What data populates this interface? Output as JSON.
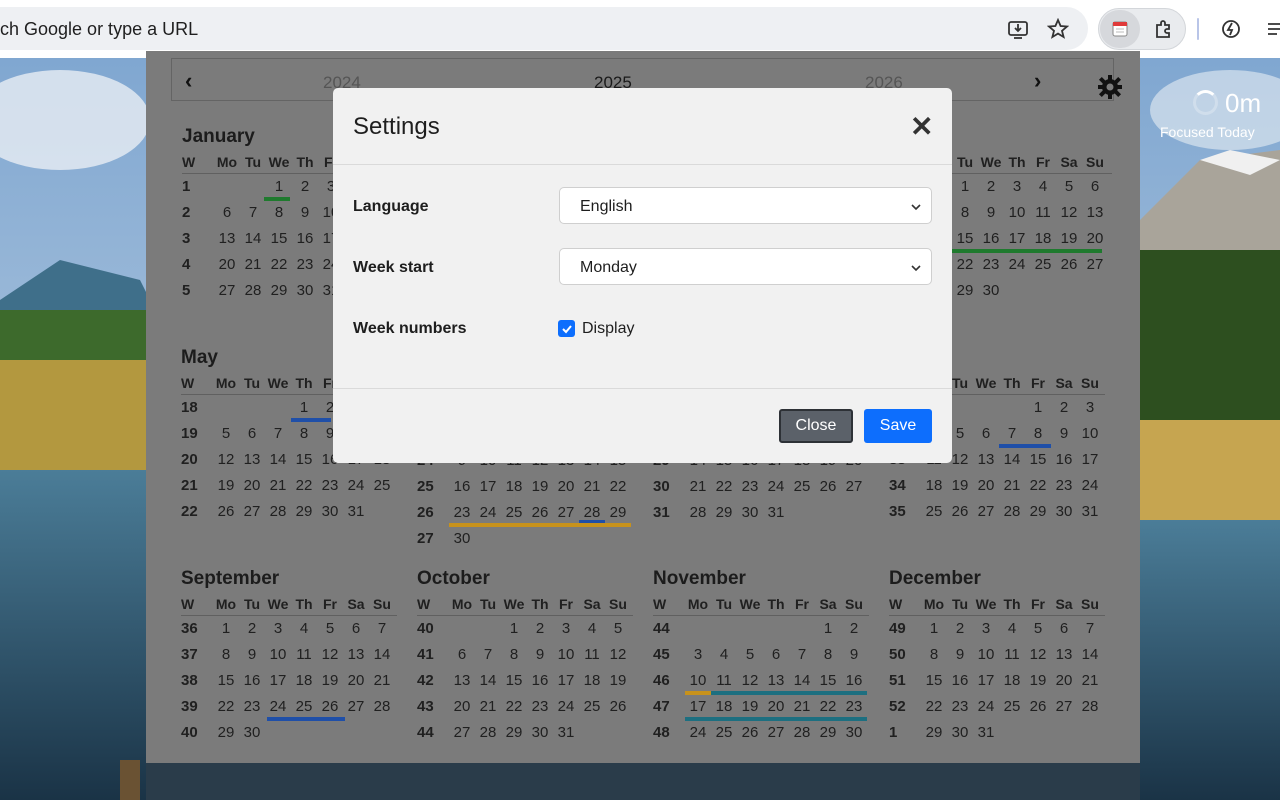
{
  "browser": {
    "omnibox_text": "ch Google or type a URL",
    "icons": [
      "install-app-icon",
      "bookmark-star-icon",
      "calendar-extension-icon",
      "extensions-puzzle-icon",
      "browser-ai-icon",
      "menu-icon"
    ]
  },
  "calendar": {
    "prev_year": "2024",
    "current_year": "2025",
    "next_year": "2026",
    "prev_arrow": "‹",
    "next_arrow": "›",
    "visible_day_headers": [
      "W",
      "Mo",
      "Tu",
      "We",
      "Th",
      "Fr"
    ],
    "full_day_headers": [
      "Tu",
      "We",
      "Th",
      "Fr",
      "Sa",
      "Su"
    ],
    "months": {
      "january": {
        "name": "January",
        "weeks": [
          "1",
          "2",
          "3",
          "4",
          "5"
        ],
        "rows": [
          [
            "",
            "",
            "1",
            "2",
            "3"
          ],
          [
            "6",
            "7",
            "8",
            "9",
            "10"
          ],
          [
            "13",
            "14",
            "15",
            "16",
            "17"
          ],
          [
            "20",
            "21",
            "22",
            "23",
            "24"
          ],
          [
            "27",
            "28",
            "29",
            "30",
            "31"
          ]
        ]
      },
      "april": {
        "rows": [
          [
            "1",
            "2",
            "3",
            "4",
            "5",
            "6"
          ],
          [
            "8",
            "9",
            "10",
            "11",
            "12",
            "13"
          ],
          [
            "15",
            "16",
            "17",
            "18",
            "19",
            "20"
          ],
          [
            "22",
            "23",
            "24",
            "25",
            "26",
            "27"
          ],
          [
            "29",
            "30",
            "",
            "",
            "",
            ""
          ]
        ]
      },
      "may": {
        "name": "May",
        "weeks": [
          "18",
          "19",
          "20",
          "21",
          "22"
        ],
        "rows": [
          [
            "",
            "",
            "",
            "1",
            "2"
          ],
          [
            "5",
            "6",
            "7",
            "8",
            "9"
          ],
          [
            "12",
            "13",
            "14",
            "15",
            "16",
            "17",
            "18"
          ],
          [
            "19",
            "20",
            "21",
            "22",
            "23",
            "24",
            "25"
          ],
          [
            "26",
            "27",
            "28",
            "29",
            "30",
            "31"
          ]
        ]
      },
      "june_partial": {
        "weeks": [
          "24",
          "25",
          "26",
          "27"
        ],
        "rows": [
          [
            "9",
            "10",
            "11",
            "12",
            "13",
            "14",
            "15"
          ],
          [
            "16",
            "17",
            "18",
            "19",
            "20",
            "21",
            "22"
          ],
          [
            "23",
            "24",
            "25",
            "26",
            "27",
            "28",
            "29"
          ],
          [
            "30",
            "",
            "",
            "",
            "",
            "",
            ""
          ]
        ]
      },
      "july_partial": {
        "weeks": [
          "29",
          "30",
          "31"
        ],
        "rows": [
          [
            "14",
            "15",
            "16",
            "17",
            "18",
            "19",
            "20"
          ],
          [
            "21",
            "22",
            "23",
            "24",
            "25",
            "26",
            "27"
          ],
          [
            "28",
            "29",
            "30",
            "31",
            "",
            "",
            ""
          ]
        ]
      },
      "august": {
        "name_fragment": "st",
        "weeks": [
          "33",
          "34",
          "35"
        ],
        "rows": [
          [
            "1",
            "2",
            "3"
          ],
          [
            "5",
            "6",
            "7",
            "8",
            "9",
            "10"
          ],
          [
            "11",
            "12",
            "13",
            "14",
            "15",
            "16",
            "17"
          ],
          [
            "18",
            "19",
            "20",
            "21",
            "22",
            "23",
            "24"
          ],
          [
            "25",
            "26",
            "27",
            "28",
            "29",
            "30",
            "31"
          ]
        ],
        "week_nums_top": [
          "",
          "",
          "33",
          "34",
          "35"
        ]
      },
      "september": {
        "name": "September",
        "weeks": [
          "36",
          "37",
          "38",
          "39",
          "40"
        ],
        "rows": [
          [
            "1",
            "2",
            "3",
            "4",
            "5",
            "6",
            "7"
          ],
          [
            "8",
            "9",
            "10",
            "11",
            "12",
            "13",
            "14"
          ],
          [
            "15",
            "16",
            "17",
            "18",
            "19",
            "20",
            "21"
          ],
          [
            "22",
            "23",
            "24",
            "25",
            "26",
            "27",
            "28"
          ],
          [
            "29",
            "30",
            "",
            "",
            "",
            "",
            ""
          ]
        ]
      },
      "october": {
        "name": "October",
        "weeks": [
          "40",
          "41",
          "42",
          "43",
          "44"
        ],
        "rows": [
          [
            "",
            "",
            "1",
            "2",
            "3",
            "4",
            "5"
          ],
          [
            "6",
            "7",
            "8",
            "9",
            "10",
            "11",
            "12"
          ],
          [
            "13",
            "14",
            "15",
            "16",
            "17",
            "18",
            "19"
          ],
          [
            "20",
            "21",
            "22",
            "23",
            "24",
            "25",
            "26"
          ],
          [
            "27",
            "28",
            "29",
            "30",
            "31",
            "",
            ""
          ]
        ]
      },
      "november": {
        "name": "November",
        "weeks": [
          "44",
          "45",
          "46",
          "47",
          "48"
        ],
        "rows": [
          [
            "",
            "",
            "",
            "",
            "",
            "1",
            "2"
          ],
          [
            "3",
            "4",
            "5",
            "6",
            "7",
            "8",
            "9"
          ],
          [
            "10",
            "11",
            "12",
            "13",
            "14",
            "15",
            "16"
          ],
          [
            "17",
            "18",
            "19",
            "20",
            "21",
            "22",
            "23"
          ],
          [
            "24",
            "25",
            "26",
            "27",
            "28",
            "29",
            "30"
          ]
        ]
      },
      "december": {
        "name": "December",
        "weeks": [
          "49",
          "50",
          "51",
          "52",
          "1"
        ],
        "rows": [
          [
            "1",
            "2",
            "3",
            "4",
            "5",
            "6",
            "7"
          ],
          [
            "8",
            "9",
            "10",
            "11",
            "12",
            "13",
            "14"
          ],
          [
            "15",
            "16",
            "17",
            "18",
            "19",
            "20",
            "21"
          ],
          [
            "22",
            "23",
            "24",
            "25",
            "26",
            "27",
            "28"
          ],
          [
            "29",
            "30",
            "31",
            "",
            "",
            "",
            ""
          ]
        ]
      }
    },
    "highlight_colors": {
      "green": "#1f7a2e",
      "blue": "#1f4fa8",
      "gold": "#c7921c",
      "teal": "#1d6f80"
    }
  },
  "focus_widget": {
    "minutes": "0m",
    "label": "Focused Today"
  },
  "settings_modal": {
    "title": "Settings",
    "close_symbol": "✕",
    "language_label": "Language",
    "language_value": "English",
    "week_start_label": "Week start",
    "week_start_value": "Monday",
    "week_numbers_label": "Week numbers",
    "week_numbers_checkbox_label": "Display",
    "week_numbers_checked": true,
    "close_button": "Close",
    "save_button": "Save"
  }
}
